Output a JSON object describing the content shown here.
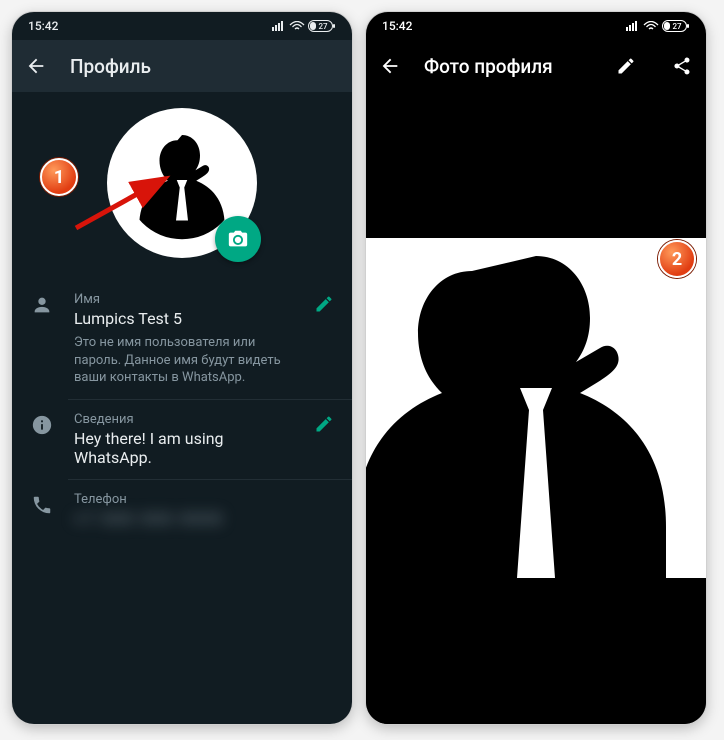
{
  "status": {
    "time": "15:42",
    "battery": "27"
  },
  "left": {
    "appbar_title": "Профиль",
    "name_label": "Имя",
    "name_value": "Lumpics Test 5",
    "name_help": "Это не имя пользователя или пароль. Данное имя будут видеть ваши контакты в WhatsApp.",
    "about_label": "Сведения",
    "about_value": "Hey there! I am using WhatsApp.",
    "phone_label": "Телефон",
    "phone_value": "+7 000 000 0000"
  },
  "right": {
    "appbar_title": "Фото профиля"
  },
  "annotations": {
    "badge1": "1",
    "badge2": "2"
  }
}
